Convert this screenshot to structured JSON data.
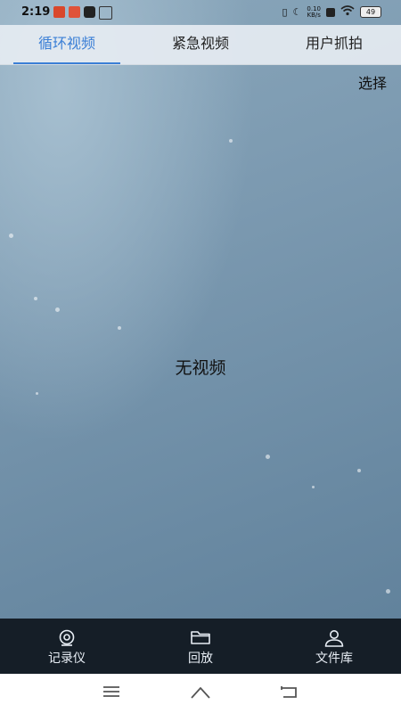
{
  "status_bar": {
    "time": "2:19",
    "network_speed_top": "0.10",
    "network_speed_bottom": "KB/s",
    "battery": "49"
  },
  "tabs": [
    {
      "label": "循环视频",
      "active": true
    },
    {
      "label": "紧急视频",
      "active": false
    },
    {
      "label": "用户抓拍",
      "active": false
    }
  ],
  "toolbar": {
    "select_label": "选择"
  },
  "content": {
    "empty_message": "无视频"
  },
  "bottom_nav": [
    {
      "label": "记录仪",
      "icon": "camera-icon"
    },
    {
      "label": "回放",
      "icon": "folder-icon"
    },
    {
      "label": "文件库",
      "icon": "user-icon"
    }
  ],
  "colors": {
    "accent": "#3b7fd6",
    "nav_background": "#151e27",
    "content_background": "#6f8ea6"
  }
}
